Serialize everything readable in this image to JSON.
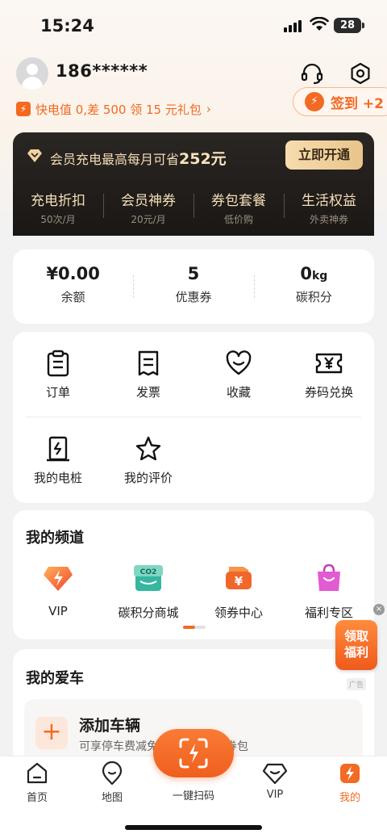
{
  "status_bar": {
    "time": "15:24",
    "battery": "28"
  },
  "profile": {
    "phone": "186******"
  },
  "promo": {
    "text": "快电值 0,差 500 领 15 元礼包",
    "arrow": "›"
  },
  "signin": {
    "label": "签到 +2"
  },
  "membership": {
    "title_prefix": "会员充电最高每月可省",
    "title_amount": "252元",
    "button": "立即开通",
    "benefits": [
      {
        "title": "充电折扣",
        "sub": "50次/月"
      },
      {
        "title": "会员神券",
        "sub": "20元/月"
      },
      {
        "title": "券包套餐",
        "sub": "低价购"
      },
      {
        "title": "生活权益",
        "sub": "外卖神券"
      }
    ]
  },
  "stats": [
    {
      "value": "¥0.00",
      "unit": "",
      "label": "余额"
    },
    {
      "value": "5",
      "unit": "",
      "label": "优惠券"
    },
    {
      "value": "0",
      "unit": "kg",
      "label": "碳积分"
    }
  ],
  "functions": [
    {
      "label": "订单",
      "icon": "clipboard-icon"
    },
    {
      "label": "发票",
      "icon": "receipt-icon"
    },
    {
      "label": "收藏",
      "icon": "heart-icon"
    },
    {
      "label": "券码兑换",
      "icon": "ticket-yen-icon"
    },
    {
      "label": "我的电桩",
      "icon": "charger-icon"
    },
    {
      "label": "我的评价",
      "icon": "star-icon"
    }
  ],
  "channel": {
    "title": "我的频道",
    "items": [
      {
        "label": "VIP",
        "icon": "vip-bolt-icon"
      },
      {
        "label": "碳积分商城",
        "icon": "co2-shop-icon"
      },
      {
        "label": "领券中心",
        "icon": "coupon-center-icon"
      },
      {
        "label": "福利专区",
        "icon": "gift-bag-icon"
      }
    ]
  },
  "car": {
    "title": "我的爱车",
    "ad_tag": "广告",
    "add_title": "添加车辆",
    "add_sub": "可享停车费减免，首次认证送券包",
    "plus": "+"
  },
  "float_gift": {
    "line1": "领取",
    "line2": "福利",
    "close": "×"
  },
  "tabs": [
    {
      "label": "首页",
      "icon": "home-icon"
    },
    {
      "label": "地图",
      "icon": "map-pin-icon"
    },
    {
      "label": "一键扫码",
      "icon": "scan-icon"
    },
    {
      "label": "VIP",
      "icon": "vip-icon"
    },
    {
      "label": "我的",
      "icon": "profile-bolt-icon"
    }
  ],
  "colors": {
    "accent": "#f26a24",
    "dark_card": "#1f1b18",
    "gold": "#f3dcb5"
  }
}
